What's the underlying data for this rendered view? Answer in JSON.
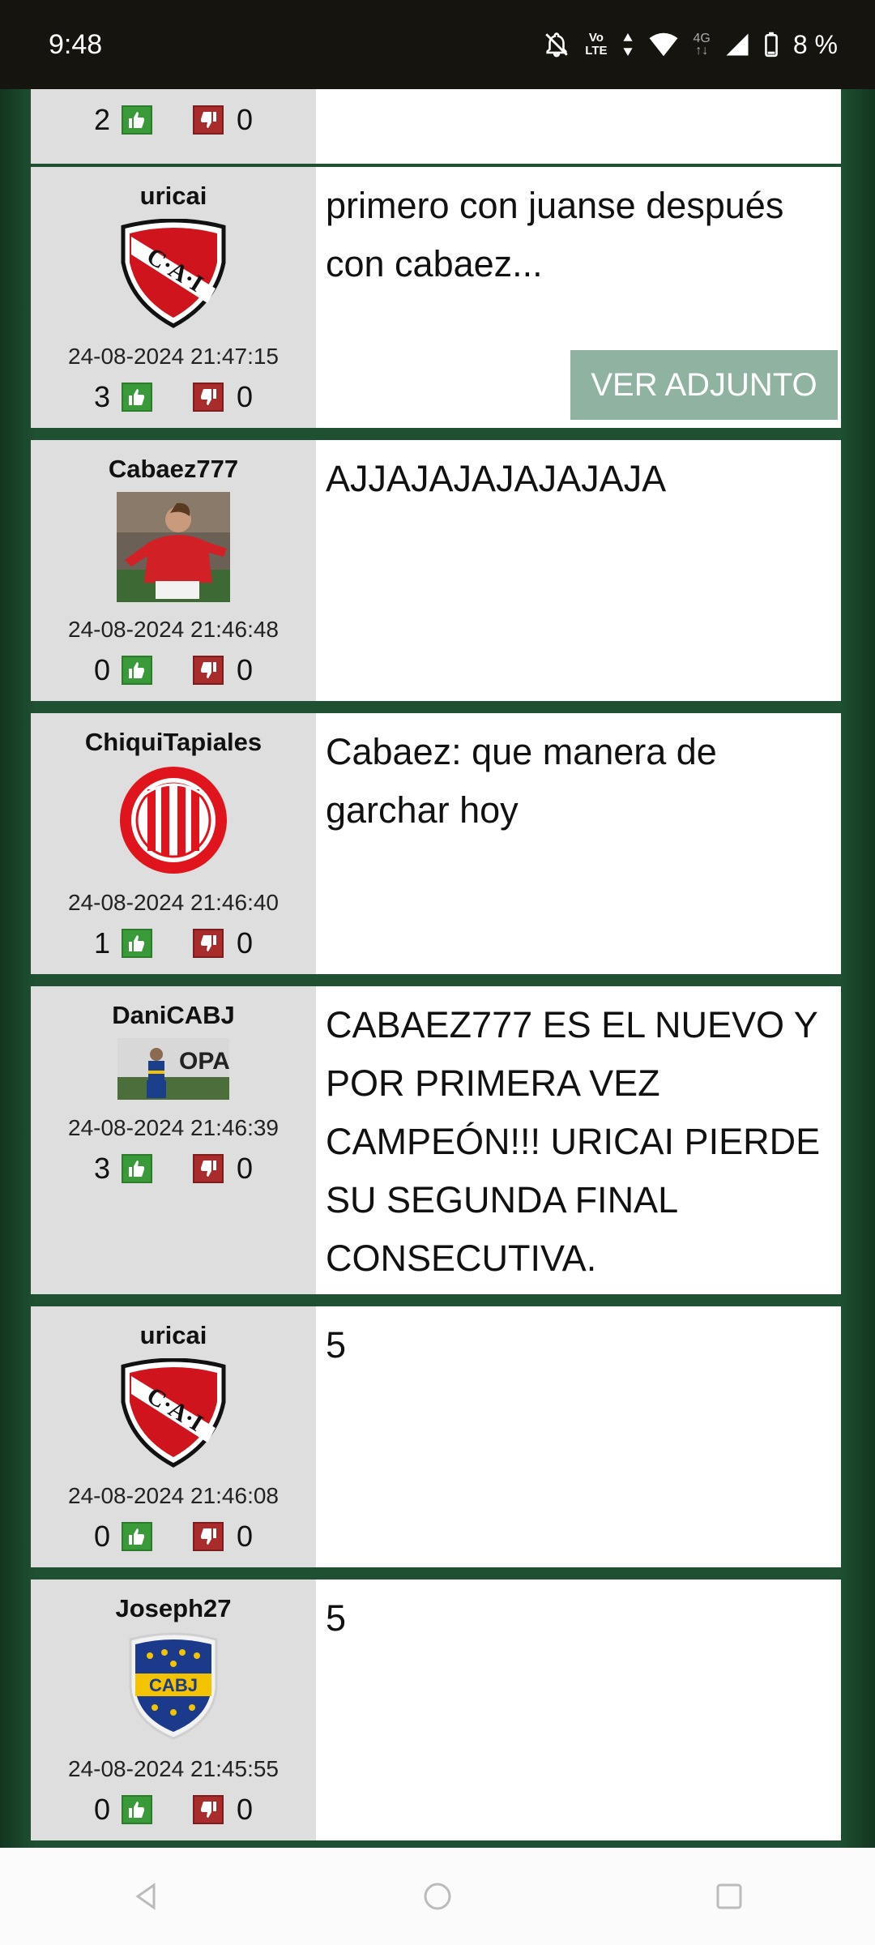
{
  "status": {
    "time": "9:48",
    "volte_top": "Vo",
    "volte_bottom": "LTE",
    "network": "4G",
    "battery": "8 %"
  },
  "attachment_label": "VER ADJUNTO",
  "partial_post": {
    "up": "2",
    "down": "0"
  },
  "posts": [
    {
      "user": "uricai",
      "avatar": "cai-shield-icon",
      "time": "24-08-2024 21:47:15",
      "up": "3",
      "down": "0",
      "message": "primero con juanse después con cabaez...",
      "has_attachment": true
    },
    {
      "user": "Cabaez777",
      "avatar": "player-photo",
      "time": "24-08-2024 21:46:48",
      "up": "0",
      "down": "0",
      "message": "AJJAJAJAJAJAJAJA"
    },
    {
      "user": "ChiquiTapiales",
      "avatar": "barracas-central-crest-icon",
      "time": "24-08-2024 21:46:40",
      "up": "1",
      "down": "0",
      "message": "Cabaez: que manera de garchar hoy"
    },
    {
      "user": "DaniCABJ",
      "avatar": "copa-photo",
      "time": "24-08-2024 21:46:39",
      "up": "3",
      "down": "0",
      "message": "CABAEZ777 ES EL NUEVO Y POR PRIMERA VEZ CAMPEÓN!!! URICAI PIERDE SU SEGUNDA FINAL CONSECUTIVA."
    },
    {
      "user": "uricai",
      "avatar": "cai-shield-icon",
      "time": "24-08-2024 21:46:08",
      "up": "0",
      "down": "0",
      "message": "5"
    },
    {
      "user": "Joseph27",
      "avatar": "cabj-crest-icon",
      "time": "24-08-2024 21:45:55",
      "up": "0",
      "down": "0",
      "message": "5"
    }
  ],
  "colors": {
    "forum_green": "#1f5032",
    "author_bg": "#dedede",
    "attach_btn": "#8fb3a0",
    "like": "#3a9a3a",
    "dislike": "#a92c2c"
  }
}
